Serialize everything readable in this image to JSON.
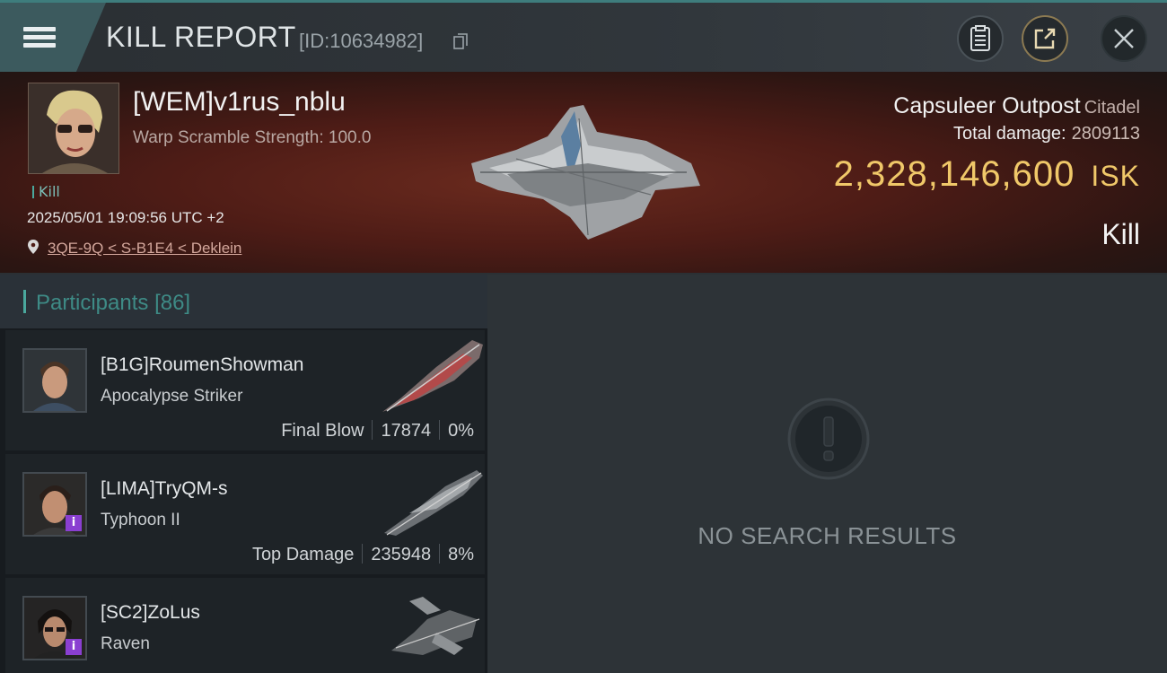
{
  "header": {
    "title": "KILL REPORT",
    "report_id": "[ID:10634982]"
  },
  "victim": {
    "name": "[WEM]v1rus_nblu",
    "subtitle": "Warp Scramble Strength: 100.0",
    "kill_tag": "Kill",
    "timestamp": "2025/05/01 19:09:56 UTC +2",
    "location": "3QE-9Q < S-B1E4 < Deklein",
    "ship_type": "Capsuleer Outpost",
    "ship_class": "Citadel",
    "total_damage_label": "Total damage:",
    "total_damage_value": "2809113",
    "isk_value": "2,328,146,600",
    "isk_unit": "ISK",
    "status": "Kill"
  },
  "participants": {
    "label": "Participants",
    "count": "[86]",
    "items": [
      {
        "name": "[B1G]RoumenShowman",
        "ship": "Apocalypse Striker",
        "role": "Final Blow",
        "damage": "17874",
        "percent": "0%",
        "badge": ""
      },
      {
        "name": "[LIMA]TryQM-s",
        "ship": "Typhoon II",
        "role": "Top Damage",
        "damage": "235948",
        "percent": "8%",
        "badge": "i"
      },
      {
        "name": "[SC2]ZoLus",
        "ship": "Raven",
        "role": "",
        "damage": "",
        "percent": "",
        "badge": "i"
      }
    ]
  },
  "results": {
    "empty_message": "NO SEARCH RESULTS"
  },
  "colors": {
    "accent_teal": "#4aa89d",
    "isk_gold": "#f0c869",
    "badge_purple": "#8a3fd1"
  }
}
